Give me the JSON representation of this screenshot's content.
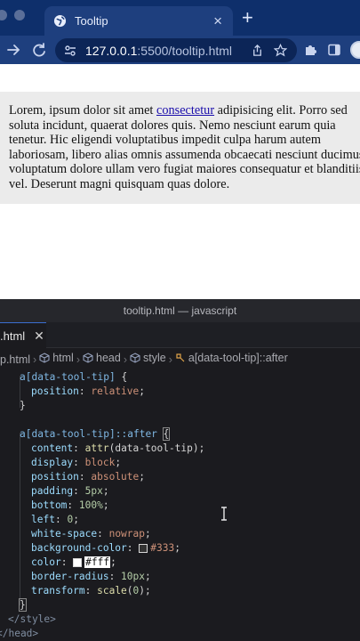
{
  "browser": {
    "tab": {
      "title": "Tooltip",
      "close_icon": "close-icon",
      "favicon": "globe-icon"
    },
    "new_tab_label": "+",
    "url": {
      "host": "127.0.0.1",
      "rest": ":5500/tooltip.html"
    },
    "colors": {
      "tabbar": "#0e2f6b",
      "toolbar": "#1e3f7e"
    }
  },
  "page": {
    "lines": [
      "Lorem, ipsum dolor sit amet ",
      "soluta incidunt, quaerat dolores quis. Nemo nesciunt earum quia",
      "tenetur. Hic eligendi voluptatibus impedit culpa harum autem",
      "laboriosam, libero alias omnis assumenda obcaecati nesciunt ducimus",
      "voluptatum dolore ullam vero fugiat maiores consequatur et blanditiis",
      "vel. Deserunt magni quisquam quas dolore."
    ],
    "link_text": "consectetur",
    "line1_tail": " adipisicing elit. Porro sed"
  },
  "editor": {
    "window_title": "tooltip.html — javascript",
    "tab_label": ".html",
    "tab_close": "✕",
    "breadcrumb": [
      "p.html",
      "html",
      "head",
      "style",
      "a[data-tool-tip]::after"
    ],
    "code": {
      "l1_sel": "a[data-tool-tip]",
      "l1_brace": " {",
      "l2_prop": "position",
      "l2_val": "relative",
      "l3": "}",
      "l5_sel": "a[data-tool-tip]::after",
      "l5_brace": "{",
      "l6_prop": "content",
      "l6_fn": "attr",
      "l6_arg": "(data-tool-tip)",
      "l7_prop": "display",
      "l7_val": "block",
      "l8_prop": "position",
      "l8_val": "absolute",
      "l9_prop": "padding",
      "l9_val": "5px",
      "l10_prop": "bottom",
      "l10_val": "100%",
      "l11_prop": "left",
      "l11_val": "0",
      "l12_prop": "white-space",
      "l12_val": "nowrap",
      "l13_prop": "background-color",
      "l13_val": "#333",
      "l14_prop": "color",
      "l14_val": "#fff",
      "l15_prop": "border-radius",
      "l15_val": "10px",
      "l16_prop": "transform",
      "l16_fn": "scale",
      "l16_arg": "(0)",
      "l17": "}",
      "l18": "</style>",
      "l19": "</head>"
    },
    "colors": {
      "background": "#1b1b1f",
      "swatch_333": "#333333",
      "swatch_fff": "#ffffff"
    }
  }
}
